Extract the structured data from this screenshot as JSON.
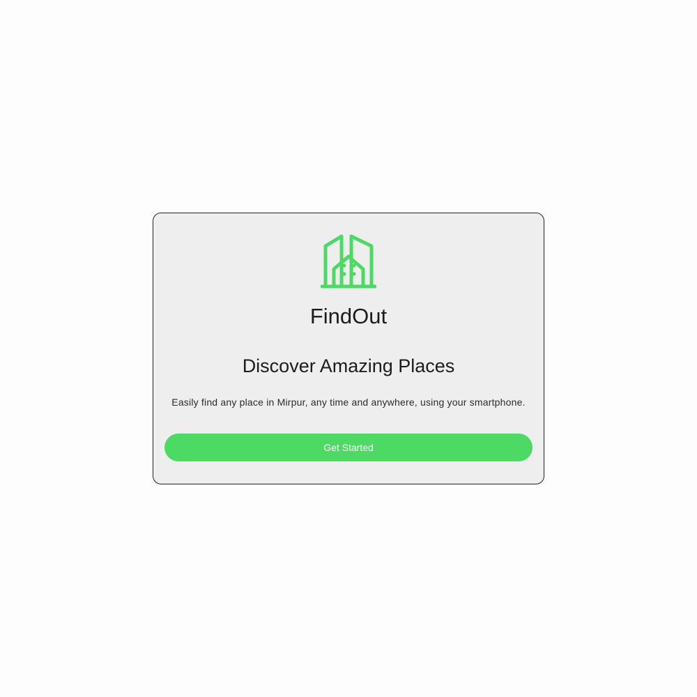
{
  "app": {
    "name": "FindOut"
  },
  "welcome": {
    "headline": "Discover Amazing Places",
    "description": "Easily find any place in Mirpur, any time and anywhere, using your smartphone.",
    "cta_label": "Get Started"
  },
  "colors": {
    "accent": "#4cd964",
    "card_background": "#eeeeee",
    "page_background": "#fdfdfd",
    "text": "#1c1c1c"
  },
  "icons": {
    "logo": "building-icon"
  }
}
